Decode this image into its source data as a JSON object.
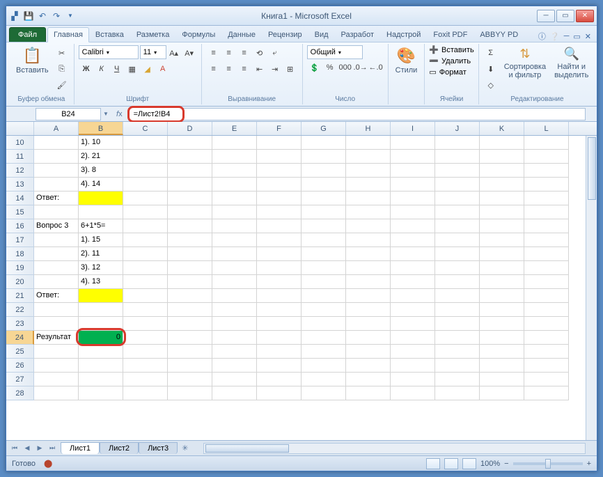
{
  "title": "Книга1 - Microsoft Excel",
  "tabs": {
    "file": "Файл",
    "home": "Главная",
    "insert": "Вставка",
    "layout": "Разметка",
    "formulas": "Формулы",
    "data": "Данные",
    "review": "Рецензир",
    "view": "Вид",
    "dev": "Разработ",
    "addins": "Надстрой",
    "foxit": "Foxit PDF",
    "abbyy": "ABBYY PD"
  },
  "ribbon": {
    "clipboard": {
      "paste": "Вставить",
      "label": "Буфер обмена"
    },
    "font": {
      "name": "Calibri",
      "size": "11",
      "label": "Шрифт"
    },
    "align": {
      "label": "Выравнивание"
    },
    "number": {
      "format": "Общий",
      "label": "Число"
    },
    "styles": {
      "btn": "Стили",
      "label": ""
    },
    "cells": {
      "insert": "Вставить",
      "delete": "Удалить",
      "format": "Формат",
      "label": "Ячейки"
    },
    "editing": {
      "sort": "Сортировка и фильтр",
      "find": "Найти и выделить",
      "label": "Редактирование"
    }
  },
  "namebox": "B24",
  "formula": "=Лист2!B4",
  "columns": [
    "A",
    "B",
    "C",
    "D",
    "E",
    "F",
    "G",
    "H",
    "I",
    "J",
    "K",
    "L"
  ],
  "rows": [
    {
      "n": 10,
      "cells": [
        "",
        "1). 10"
      ]
    },
    {
      "n": 11,
      "cells": [
        "",
        "2). 21"
      ]
    },
    {
      "n": 12,
      "cells": [
        "",
        "3). 8"
      ]
    },
    {
      "n": 13,
      "cells": [
        "",
        "4). 14"
      ]
    },
    {
      "n": 14,
      "cells": [
        "Ответ:",
        ""
      ],
      "yellowB": true
    },
    {
      "n": 15,
      "cells": [
        "",
        ""
      ]
    },
    {
      "n": 16,
      "cells": [
        "Вопрос 3",
        "6+1*5="
      ]
    },
    {
      "n": 17,
      "cells": [
        "",
        "1). 15"
      ]
    },
    {
      "n": 18,
      "cells": [
        "",
        "2). 11"
      ]
    },
    {
      "n": 19,
      "cells": [
        "",
        "3). 12"
      ]
    },
    {
      "n": 20,
      "cells": [
        "",
        "4). 13"
      ]
    },
    {
      "n": 21,
      "cells": [
        "Ответ:",
        ""
      ],
      "yellowB": true
    },
    {
      "n": 22,
      "cells": [
        "",
        ""
      ]
    },
    {
      "n": 23,
      "cells": [
        "",
        ""
      ]
    },
    {
      "n": 24,
      "cells": [
        "Результат",
        "0"
      ],
      "greenB": true
    },
    {
      "n": 25,
      "cells": [
        "",
        ""
      ]
    },
    {
      "n": 26,
      "cells": [
        "",
        ""
      ]
    },
    {
      "n": 27,
      "cells": [
        "",
        ""
      ]
    },
    {
      "n": 28,
      "cells": [
        "",
        ""
      ]
    }
  ],
  "sheets": [
    "Лист1",
    "Лист2",
    "Лист3"
  ],
  "status": "Готово",
  "zoom": "100%"
}
